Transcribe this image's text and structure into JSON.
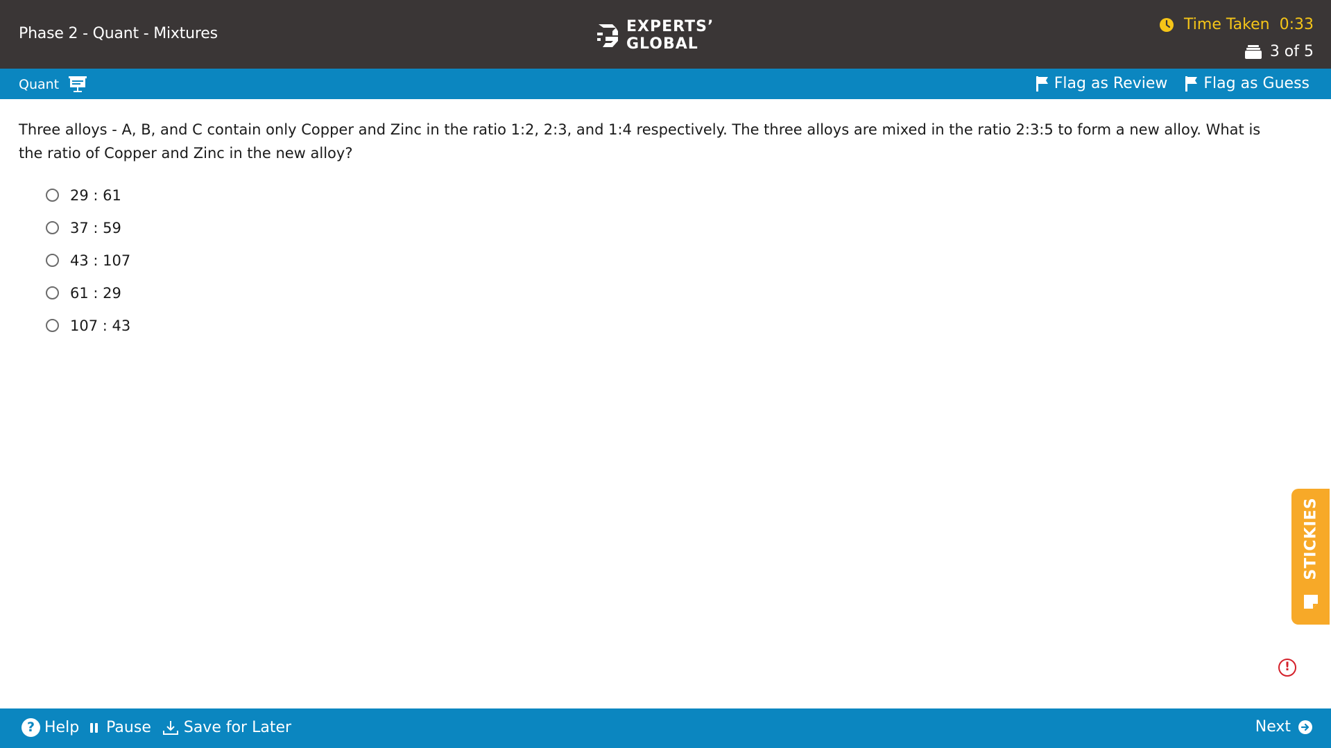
{
  "header": {
    "section_title": "Phase 2 - Quant - Mixtures",
    "logo_line1": "EXPERTS’",
    "logo_line2": "GLOBAL",
    "timer_label": "Time Taken",
    "timer_value": "0:33",
    "question_progress": "3 of 5"
  },
  "subbar": {
    "subject": "Quant",
    "flag_review_label": "Flag as Review",
    "flag_guess_label": "Flag as Guess"
  },
  "question": {
    "text": "Three alloys - A, B, and C contain only Copper and Zinc in the ratio 1:2, 2:3, and 1:4 respectively. The three alloys are mixed in the ratio 2:3:5 to form a new alloy. What is the ratio of Copper and Zinc in the new alloy?",
    "options": [
      "29 : 61",
      "37 : 59",
      "43 : 107",
      "61 : 29",
      "107 : 43"
    ],
    "selected": null
  },
  "stickies": {
    "label": "STICKIES"
  },
  "report_icon_glyph": "!",
  "footer": {
    "help_glyph": "?",
    "help_label": "Help",
    "pause_label": "Pause",
    "save_label": "Save for Later",
    "next_label": "Next"
  },
  "colors": {
    "header_bg": "#3a3636",
    "accent_blue": "#0b86c0",
    "timer_yellow": "#f5c518",
    "stickies_orange": "#f7a928",
    "report_red": "#d4202a"
  },
  "icons": [
    "logo-icon",
    "clock-icon",
    "question-stack-icon",
    "whiteboard-icon",
    "flag-icon",
    "note-icon",
    "alert-icon",
    "help-icon",
    "pause-icon",
    "download-icon",
    "arrow-right-icon"
  ]
}
